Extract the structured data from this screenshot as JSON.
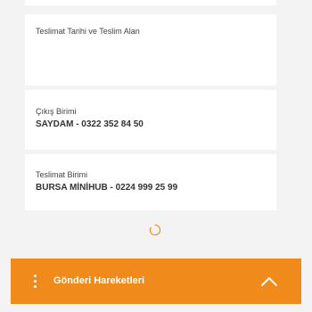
{
  "delivery": {
    "label": "Teslimat Tarihi ve Teslim Alan"
  },
  "origin": {
    "label": "Çıkış Birimi",
    "value": "SAYDAM - 0322 352 84 50"
  },
  "destination": {
    "label": "Teslimat Birimi",
    "value": "BURSA MİNİHUB - 0224 999 25 99"
  },
  "bottom_bar": {
    "title": "Gönderi Hareketleri",
    "color": "#f08a1a",
    "menu_icon": "vertical-dots-icon",
    "toggle_icon": "chevron-up-icon"
  },
  "loading_icon": "spinner-icon"
}
